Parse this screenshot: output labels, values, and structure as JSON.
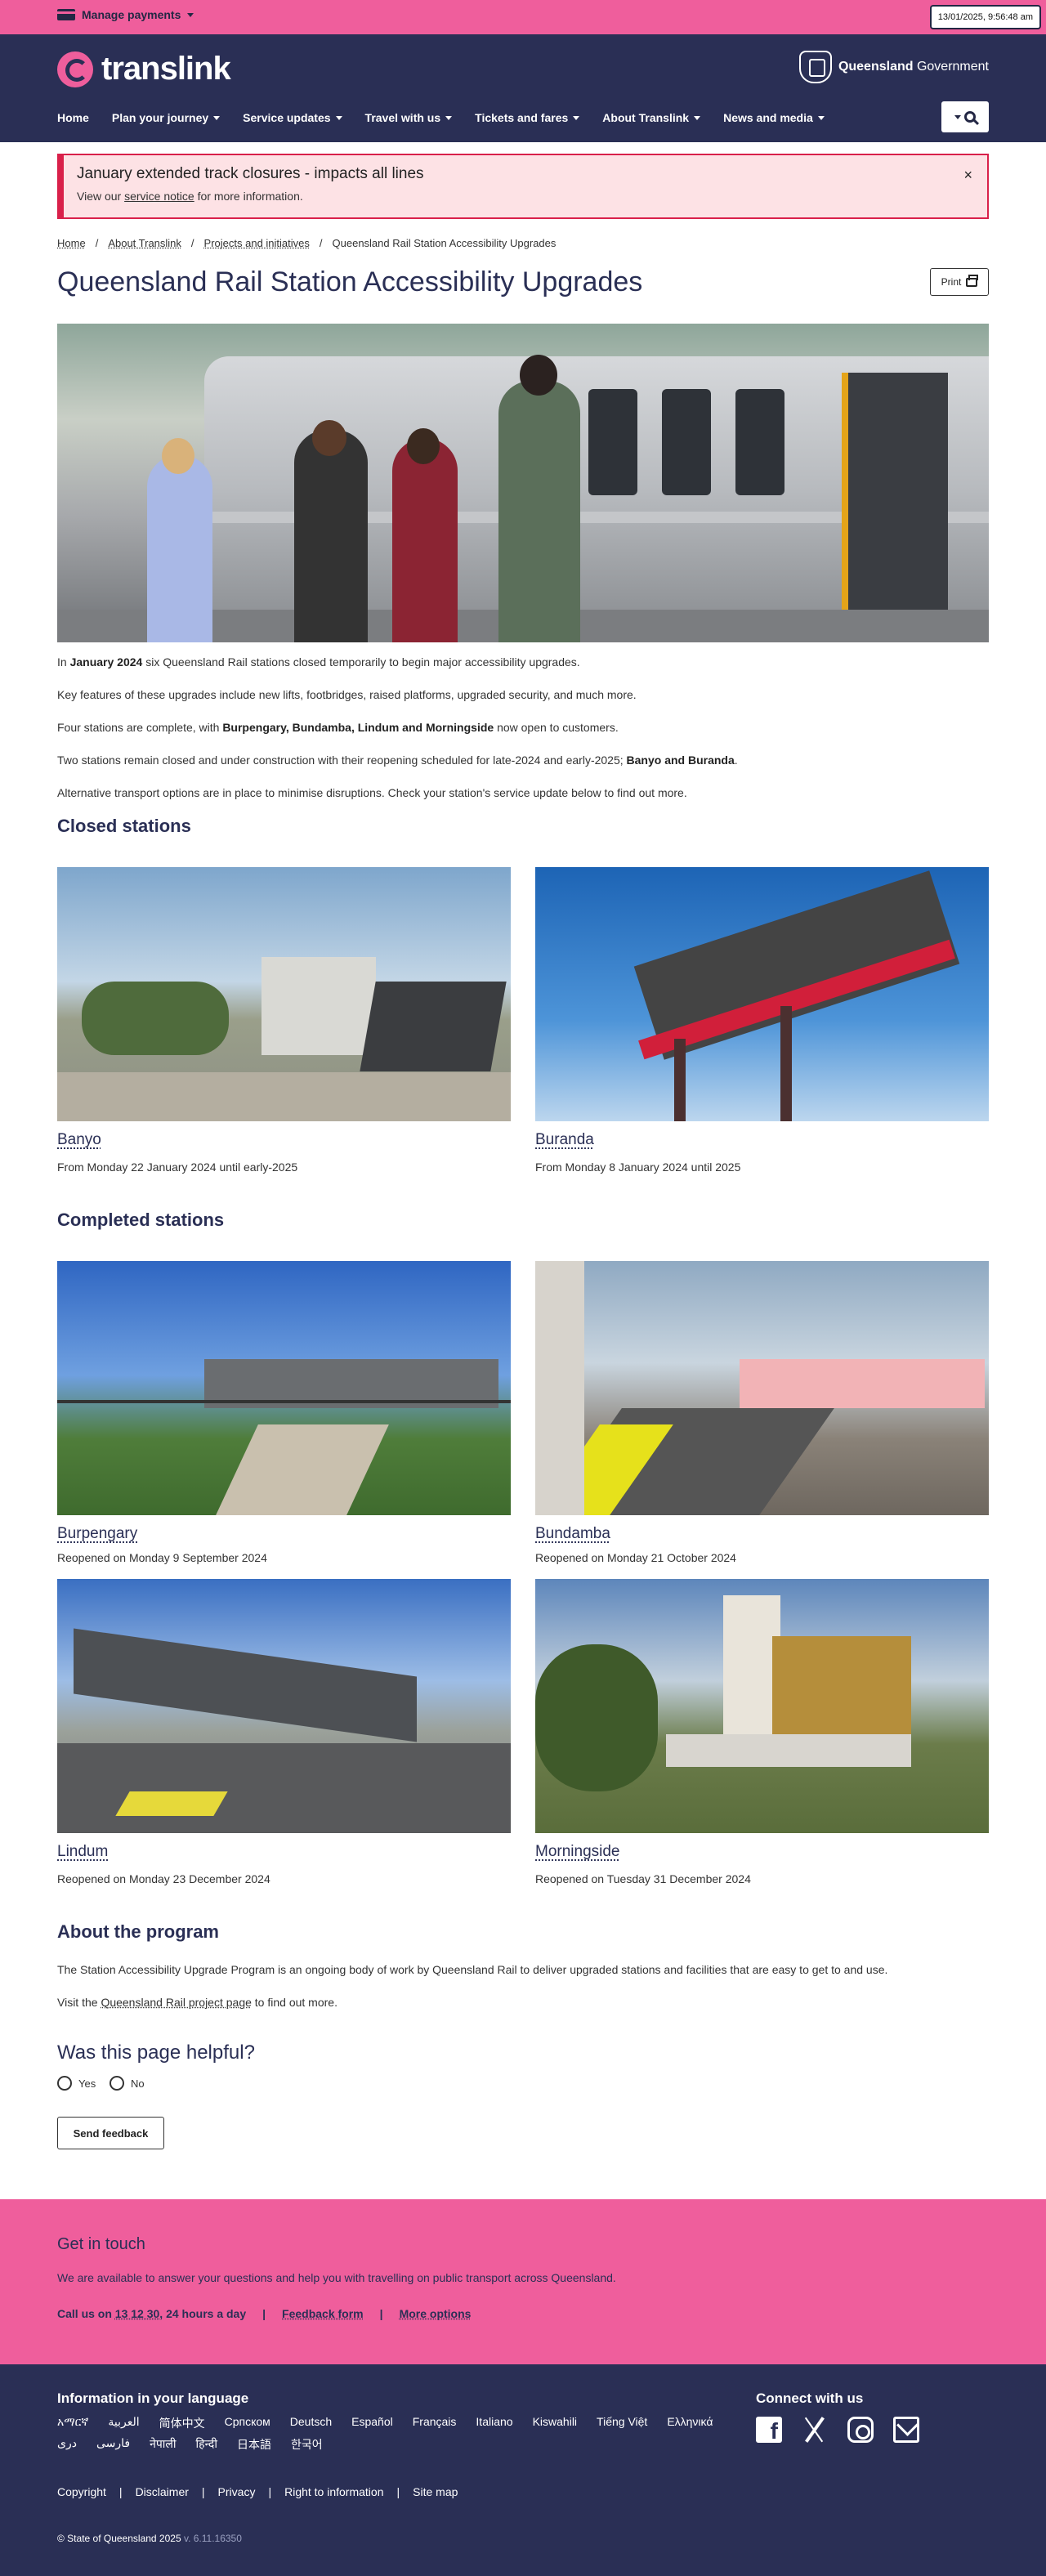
{
  "utility": {
    "manage_payments": "Manage payments",
    "timestamp": "13/01/2025, 9:56:48 am"
  },
  "header": {
    "logo_text": "translink",
    "gov_bold": "Queensland",
    "gov_rest": " Government"
  },
  "nav": {
    "items": [
      "Home",
      "Plan your journey",
      "Service updates",
      "Travel with us",
      "Tickets and fares",
      "About Translink",
      "News and media"
    ]
  },
  "alert": {
    "title": "January extended track closures - impacts all lines",
    "text_before": "View our ",
    "link": "service notice",
    "text_after": " for more information.",
    "close": "×"
  },
  "breadcrumb": {
    "items": [
      "Home",
      "About Translink",
      "Projects and initiatives"
    ],
    "current": "Queensland Rail Station Accessibility Upgrades",
    "separator": "/"
  },
  "page": {
    "title": "Queensland Rail Station Accessibility Upgrades",
    "print_label": "Print"
  },
  "intro": {
    "p1_a": "In ",
    "p1_b": "January 2024",
    "p1_c": " six Queensland Rail stations closed temporarily to begin major accessibility upgrades.",
    "p2": "Key features of these upgrades include new lifts, footbridges, raised platforms, upgraded security, and much more.",
    "p3_a": "Four stations are complete, with ",
    "p3_b": "Burpengary, Bundamba, Lindum and Morningside",
    "p3_c": " now open to customers.",
    "p4_a": "Two stations remain closed and under construction with their reopening scheduled for late-2024 and early-2025; ",
    "p4_b": "Banyo and Buranda",
    "p4_c": ".",
    "p5": "Alternative transport options are in place to minimise disruptions. Check your station's service update below to find out more."
  },
  "closed": {
    "heading": "Closed stations",
    "stations": [
      {
        "name": "Banyo",
        "date": "From Monday 22 January 2024 until early-2025"
      },
      {
        "name": "Buranda",
        "date": "From Monday 8 January 2024 until 2025"
      }
    ]
  },
  "completed": {
    "heading": "Completed stations",
    "stations": [
      {
        "name": "Burpengary",
        "date": "Reopened on Monday 9 September 2024"
      },
      {
        "name": "Bundamba",
        "date": "Reopened on Monday 21 October 2024"
      },
      {
        "name": "Lindum",
        "date": "Reopened on Monday 23 December 2024"
      },
      {
        "name": "Morningside",
        "date": "Reopened on Tuesday 31 December 2024"
      }
    ]
  },
  "about": {
    "heading": "About the program",
    "p1": "The Station Accessibility Upgrade Program is an ongoing body of work by Queensland Rail to deliver upgraded stations and facilities that are easy to get to and use.",
    "p2_a": "Visit the ",
    "p2_link": "Queensland Rail project page",
    "p2_b": " to find out more."
  },
  "feedback": {
    "heading": "Was this page helpful?",
    "yes": "Yes",
    "no": "No",
    "send": "Send feedback"
  },
  "touch": {
    "heading": "Get in touch",
    "desc": "We are available to answer your questions and help you with travelling on public transport across Queensland.",
    "call_a": "Call us on ",
    "call_number": "13 12 30",
    "call_b": ", 24 hours a day",
    "feedback_form": "Feedback form",
    "more_options": "More options",
    "sep": "|"
  },
  "footer": {
    "lang_heading": "Information in your language",
    "languages": [
      "አማርኛ",
      "العربية",
      "简体中文",
      "Српском",
      "Deutsch",
      "Español",
      "Français",
      "Italiano",
      "Kiswahili",
      "Tiếng Việt",
      "Ελληνικά",
      "دری",
      "فارسی",
      "नेपाली",
      "हिन्दी",
      "日本語",
      "한국어"
    ],
    "connect_heading": "Connect with us",
    "links": [
      "Copyright",
      "Disclaimer",
      "Privacy",
      "Right to information",
      "Site map"
    ],
    "copyright": "© State of Queensland 2025",
    "version": " v. 6.11.16350"
  }
}
